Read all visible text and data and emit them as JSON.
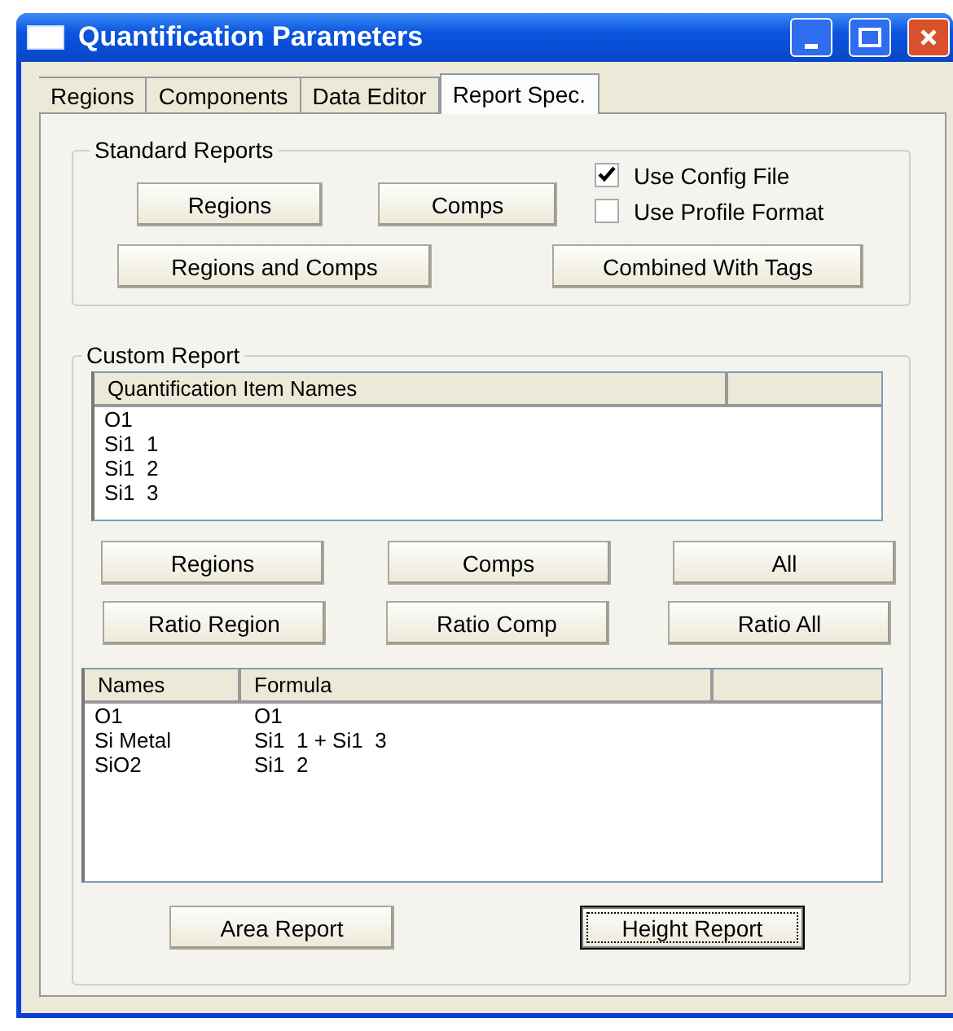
{
  "window": {
    "title": "Quantification Parameters"
  },
  "tabs": [
    {
      "label": "Regions",
      "selected": false
    },
    {
      "label": "Components",
      "selected": false
    },
    {
      "label": "Data Editor",
      "selected": false
    },
    {
      "label": "Report Spec.",
      "selected": true
    }
  ],
  "standard_reports": {
    "title": "Standard Reports",
    "buttons_row_1": [
      "Regions",
      "Comps"
    ],
    "checkboxes": [
      {
        "label": "Use Config File",
        "checked": true
      },
      {
        "label": "Use Profile Format",
        "checked": false
      }
    ],
    "buttons_row_2": [
      "Regions and Comps",
      "Combined With Tags"
    ]
  },
  "custom_report": {
    "title": "Custom Report",
    "items_list": {
      "columns": [
        "Quantification Item Names"
      ],
      "rows": [
        "O1",
        "Si1  1",
        "Si1  2",
        "Si1  3"
      ]
    },
    "buttons_row_1": [
      "Regions",
      "Comps",
      "All"
    ],
    "buttons_row_2": [
      "Ratio Region",
      "Ratio Comp",
      "Ratio All"
    ],
    "formula_list": {
      "columns": [
        "Names",
        "Formula"
      ],
      "rows": [
        {
          "name": "O1",
          "formula": "O1"
        },
        {
          "name": "Si Metal",
          "formula": "Si1  1 + Si1  3"
        },
        {
          "name": "SiO2",
          "formula": "Si1  2"
        }
      ]
    },
    "report_buttons": [
      {
        "label": "Area Report",
        "default": false
      },
      {
        "label": "Height Report",
        "default": true
      }
    ]
  }
}
